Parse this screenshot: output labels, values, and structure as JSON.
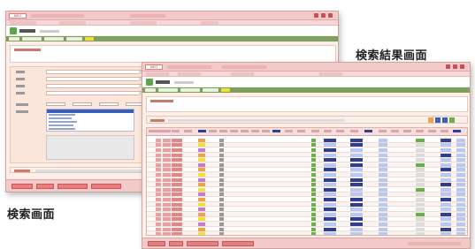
{
  "captions": {
    "result_screen": "検索結果画面",
    "search_screen": "検索画面"
  },
  "colors": {
    "title_bar": "#f4c9c9",
    "toolbar": "#7fa05a",
    "highlight_blue": "#3a5fb8",
    "button_red": "#e77f7f",
    "cell_orange": "#f2a04a",
    "cell_yellow": "#f3df3a",
    "cell_navy": "#2f3f8f",
    "cell_lightblue": "#b9c8f0",
    "cell_green": "#68b04a"
  },
  "icons": [
    "app-logo-icon",
    "screen-icon",
    "window-control-icon",
    "dropdown-arrow-icon"
  ],
  "search_window": {
    "logo": "NEO",
    "title_text": "",
    "screen_title": "",
    "listbox_selected_index": 0
  },
  "result_window": {
    "logo": "NEO",
    "title_text": "",
    "screen_title": ""
  }
}
